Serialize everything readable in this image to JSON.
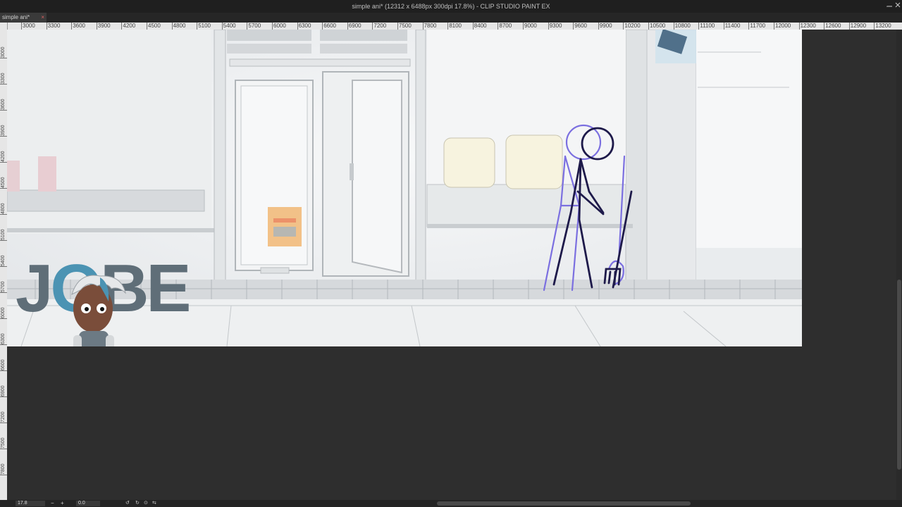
{
  "window": {
    "title": "simple ani* (12312 x 6488px 300dpi 17.8%)  - CLIP STUDIO PAINT EX",
    "minimize_icon": "minimize-icon",
    "maximize_icon": "maximize-icon",
    "close_icon": "close-icon"
  },
  "tabs": [
    {
      "label": "simple ani*",
      "close_glyph": "×"
    }
  ],
  "ruler_h": [
    "3000",
    "3300",
    "3600",
    "3900",
    "4200",
    "4500",
    "4800",
    "5100",
    "5400",
    "5700",
    "6000",
    "6300",
    "6600",
    "6900",
    "7200",
    "7500",
    "7800",
    "8100",
    "8400",
    "8700",
    "9000",
    "9300",
    "9600",
    "9900",
    "10200",
    "10500",
    "10800",
    "11100",
    "11400",
    "11700",
    "12000",
    "12300",
    "12600",
    "12900",
    "13200"
  ],
  "ruler_v": [
    "3000",
    "3300",
    "3600",
    "3900",
    "4200",
    "4500",
    "4800",
    "5100",
    "5400",
    "5700",
    "6000",
    "6300",
    "6600",
    "6900",
    "7200",
    "7500",
    "7800"
  ],
  "logo": {
    "part1": "J",
    "part2": "O",
    "part3": "BE"
  },
  "status": {
    "zoom": "17.8",
    "rotation": "0.0"
  },
  "colors": {
    "sketch_purple": "#7b6fe0",
    "sketch_dark": "#1e1a4a",
    "logo_gray": "#5f6e78",
    "logo_blue": "#4b93b3"
  }
}
